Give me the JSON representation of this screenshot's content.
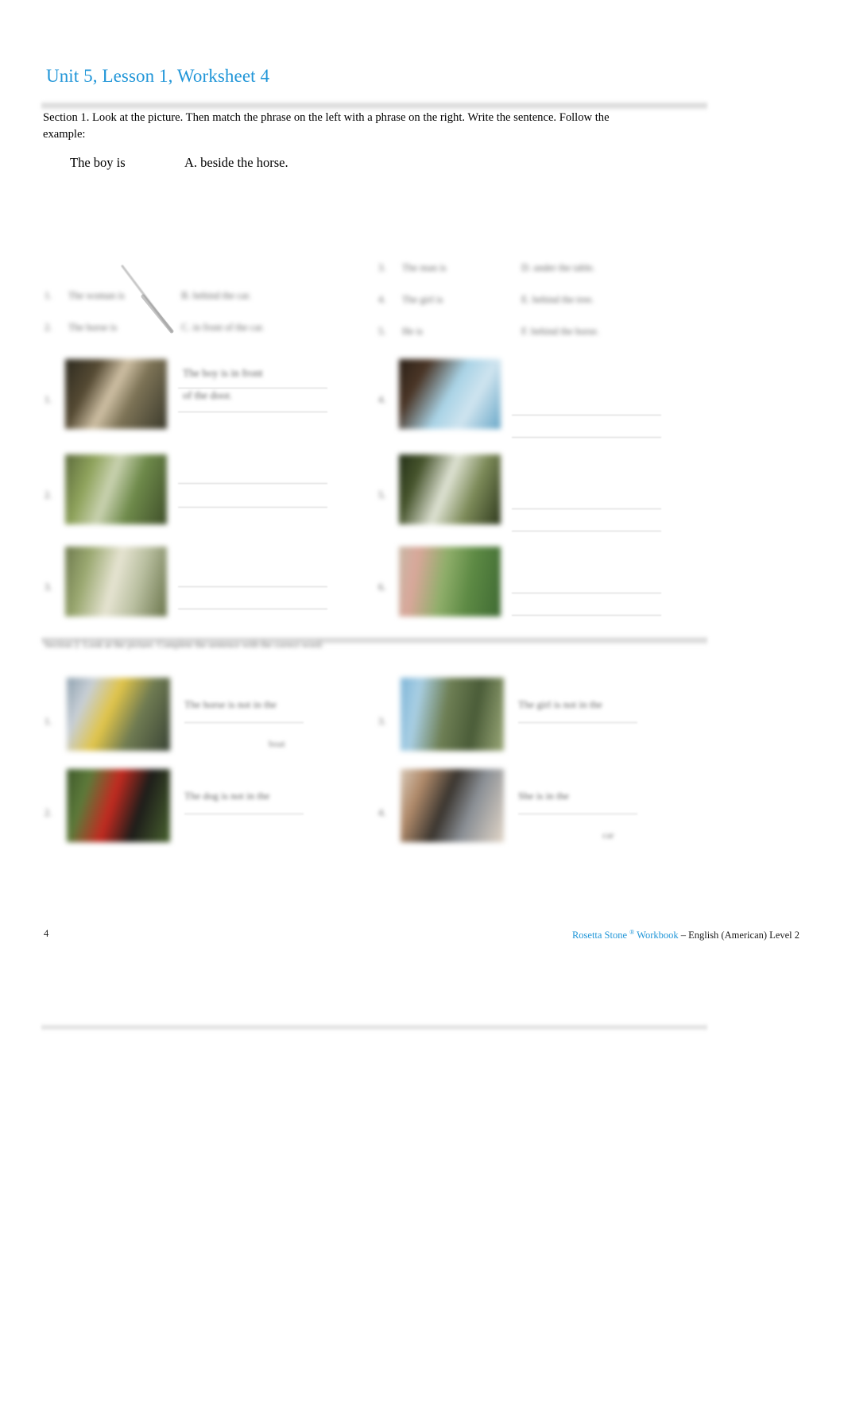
{
  "document": {
    "title": "Unit 5, Lesson 1, Worksheet 4",
    "title_color": "#2196d8"
  },
  "section1": {
    "instructions": "Section 1. Look at the picture. Then match the phrase on the left with a phrase on the right. Write the sentence. Follow the example:",
    "example": {
      "left": "The boy is",
      "right": "A. beside the horse."
    },
    "match_left": [
      {
        "num": "1.",
        "cue": "The woman is",
        "option": "B. behind the car."
      },
      {
        "num": "2.",
        "cue": "The horse is",
        "option": "C. in front of the car."
      }
    ],
    "match_right": [
      {
        "num": "3.",
        "cue": "The man is",
        "option": "D. under the table."
      },
      {
        "num": "4.",
        "cue": "The girl is",
        "option": "E. behind the tree."
      },
      {
        "num": "5.",
        "cue": "He is",
        "option": "F. behind the horse."
      }
    ],
    "rows_left": [
      {
        "num": "1.",
        "answer_line1": "The boy is in front",
        "answer_line2": "of the door."
      },
      {
        "num": "2.",
        "answer_line1": "",
        "answer_line2": ""
      },
      {
        "num": "3.",
        "answer_line1": "",
        "answer_line2": ""
      }
    ],
    "rows_right": [
      {
        "num": "4.",
        "answer_line1": "",
        "answer_line2": ""
      },
      {
        "num": "5.",
        "answer_line1": "",
        "answer_line2": ""
      },
      {
        "num": "6.",
        "answer_line1": "",
        "answer_line2": ""
      }
    ]
  },
  "section2": {
    "instructions": "Section 2. Look at the picture. Complete the sentence with the correct word:",
    "rows": [
      {
        "num": "1.",
        "text": "The horse is not in the",
        "blank_word": "boat"
      },
      {
        "num": "2.",
        "text": "The dog is not in the",
        "blank_word": ""
      },
      {
        "num": "3.",
        "text": "The girl is not in the",
        "blank_word": ""
      },
      {
        "num": "4.",
        "text": "She is in the",
        "blank_word": "car"
      }
    ]
  },
  "footer": {
    "page_number": "4",
    "brand": "Rosetta Stone",
    "registered_mark": "®",
    "product": "Workbook",
    "course": "– English (American) Level 2"
  }
}
